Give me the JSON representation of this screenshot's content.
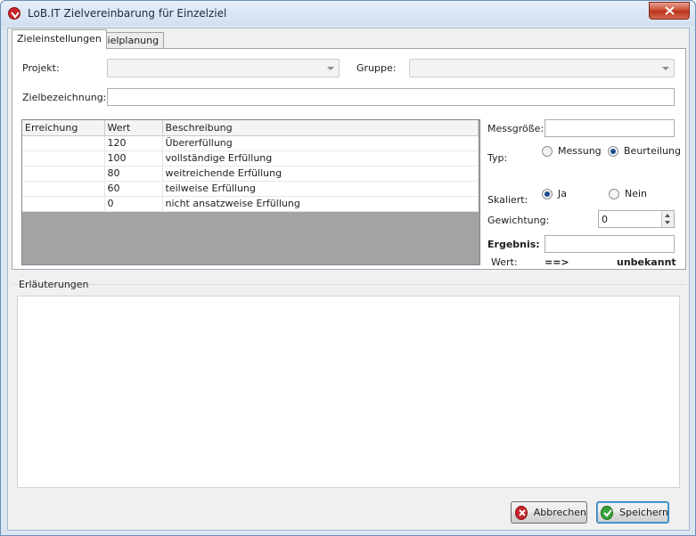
{
  "window": {
    "title": "LoB.IT Zielvereinbarung für Einzelziel"
  },
  "tabs": [
    {
      "label": "Zieleinstellungen",
      "active": true
    },
    {
      "label": "Zielplanung",
      "active": false
    }
  ],
  "form": {
    "projekt_label": "Projekt:",
    "projekt_value": "",
    "gruppe_label": "Gruppe:",
    "gruppe_value": "",
    "zielbezeichnung_label": "Zielbezeichnung:",
    "zielbezeichnung_value": ""
  },
  "grid": {
    "columns": [
      "Erreichung",
      "Wert",
      "Beschreibung"
    ],
    "rows": [
      {
        "erreichung": "",
        "wert": "120",
        "beschreibung": "Übererfüllung"
      },
      {
        "erreichung": "",
        "wert": "100",
        "beschreibung": "vollständige Erfüllung"
      },
      {
        "erreichung": "",
        "wert": "80",
        "beschreibung": "weitreichende Erfüllung"
      },
      {
        "erreichung": "",
        "wert": "60",
        "beschreibung": "teilweise Erfüllung"
      },
      {
        "erreichung": "",
        "wert": "0",
        "beschreibung": "nicht ansatzweise Erfüllung"
      }
    ]
  },
  "right_panel": {
    "messgroesse_label": "Messgröße:",
    "messgroesse_value": "",
    "typ_label": "Typ:",
    "typ_options": [
      "Messung",
      "Beurteilung"
    ],
    "typ_selected": "Beurteilung",
    "skaliert_label": "Skaliert:",
    "skaliert_options": [
      "Ja",
      "Nein"
    ],
    "skaliert_selected": "Ja",
    "gewichtung_label": "Gewichtung:",
    "gewichtung_value": "0",
    "ergebnis_label": "Ergebnis:",
    "ergebnis_value": "",
    "wert_label": "Wert:",
    "wert_arrow": "==>",
    "wert_result": "unbekannt"
  },
  "notes": {
    "label": "Erläuterungen",
    "value": ""
  },
  "buttons": {
    "cancel_label": "Abbrechen",
    "save_label": "Speichern"
  },
  "colors": {
    "accent": "#1c4f8e",
    "cancel_icon": "#c9242b",
    "save_icon": "#3aa33a",
    "grid_empty_area": "#a3a3a3"
  }
}
